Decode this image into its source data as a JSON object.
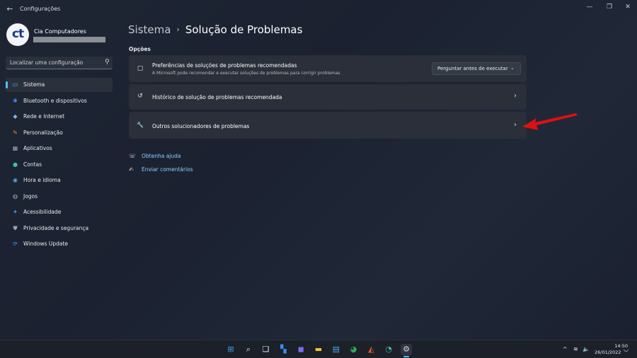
{
  "app": {
    "title": "Configurações",
    "back_glyph": "←",
    "minimize_glyph": "—",
    "maximize_glyph": "❐",
    "close_glyph": "✕"
  },
  "profile": {
    "avatar_text": "ct",
    "name": "Cia Computadores"
  },
  "search": {
    "placeholder": "Localizar uma configuração",
    "icon": "search-icon"
  },
  "sidebar": {
    "items": [
      {
        "label": "Sistema",
        "icon": "monitor-icon",
        "glyph": "▭",
        "color": "#4cc2ff",
        "active": true
      },
      {
        "label": "Bluetooth e dispositivos",
        "icon": "bluetooth-icon",
        "glyph": "✱",
        "color": "#3a8cf0"
      },
      {
        "label": "Rede e Internet",
        "icon": "wifi-icon",
        "glyph": "◆",
        "color": "#7ab8e8"
      },
      {
        "label": "Personalização",
        "icon": "brush-icon",
        "glyph": "✎",
        "color": "#e08a4a"
      },
      {
        "label": "Aplicativos",
        "icon": "apps-icon",
        "glyph": "▦",
        "color": "#9aa6b8"
      },
      {
        "label": "Contas",
        "icon": "account-icon",
        "glyph": "●",
        "color": "#3cc59a"
      },
      {
        "label": "Hora e idioma",
        "icon": "globe-clock-icon",
        "glyph": "◉",
        "color": "#4aa8e8"
      },
      {
        "label": "Jogos",
        "icon": "gamepad-icon",
        "glyph": "◍",
        "color": "#a9b2c0"
      },
      {
        "label": "Acessibilidade",
        "icon": "accessibility-icon",
        "glyph": "✦",
        "color": "#4aa0f0"
      },
      {
        "label": "Privacidade e segurança",
        "icon": "shield-icon",
        "glyph": "⛊",
        "color": "#9aa2ae"
      },
      {
        "label": "Windows Update",
        "icon": "windows-update-icon",
        "glyph": "⟳",
        "color": "#3aa0f0"
      }
    ]
  },
  "main": {
    "breadcrumb_parent": "Sistema",
    "breadcrumb_sep": "›",
    "breadcrumb_current": "Solução de Problemas",
    "section_label": "Opções",
    "cards": [
      {
        "title": "Preferências de soluções de problemas recomendadas",
        "description": "A Microsoft pode recomendar e executar soluções de problemas para corrigir problemas",
        "icon": "chat-bubble-icon",
        "glyph": "▢",
        "dropdown_value": "Perguntar antes de executar",
        "dropdown_caret": "⌄"
      },
      {
        "title": "Histórico de solução de problemas recomendada",
        "icon": "history-icon",
        "glyph": "↺",
        "chevron": "›"
      },
      {
        "title": "Outros solucionadores de problemas",
        "icon": "wrench-icon",
        "glyph": "🔧",
        "chevron": "›"
      }
    ],
    "links": [
      {
        "label": "Obtenha ajuda",
        "icon": "help-icon",
        "glyph": "☏"
      },
      {
        "label": "Enviar comentários",
        "icon": "feedback-icon",
        "glyph": "✍"
      }
    ]
  },
  "annotation": {
    "color": "#e01010"
  },
  "taskbar": {
    "apps": [
      {
        "name": "windows-start-icon",
        "glyph": "⊞",
        "color": "#3aa0f0"
      },
      {
        "name": "search-taskbar-icon",
        "glyph": "⌕",
        "color": "#e6e8ec"
      },
      {
        "name": "task-view-icon",
        "glyph": "❏",
        "color": "#e6e8ec"
      },
      {
        "name": "widgets-icon",
        "glyph": "▚",
        "color": "#3a8cf0"
      },
      {
        "name": "teams-chat-icon",
        "glyph": "◼",
        "color": "#7b6cf0"
      },
      {
        "name": "file-explorer-icon",
        "glyph": "▬",
        "color": "#f0c040"
      },
      {
        "name": "notepad-icon",
        "glyph": "▤",
        "color": "#4aa8e8"
      },
      {
        "name": "chrome-icon",
        "glyph": "◕",
        "color": "#34a853"
      },
      {
        "name": "brave-icon",
        "glyph": "◭",
        "color": "#fb542b"
      },
      {
        "name": "edge-icon",
        "glyph": "◔",
        "color": "#35c0a0"
      },
      {
        "name": "settings-gear-icon",
        "glyph": "⚙",
        "color": "#d6d9de",
        "active": true
      }
    ],
    "tray": {
      "chevron": "^",
      "wifi": "≋",
      "volume": "🔈",
      "notifications": "◡"
    },
    "time": "14:50",
    "date": "26/01/2022"
  }
}
